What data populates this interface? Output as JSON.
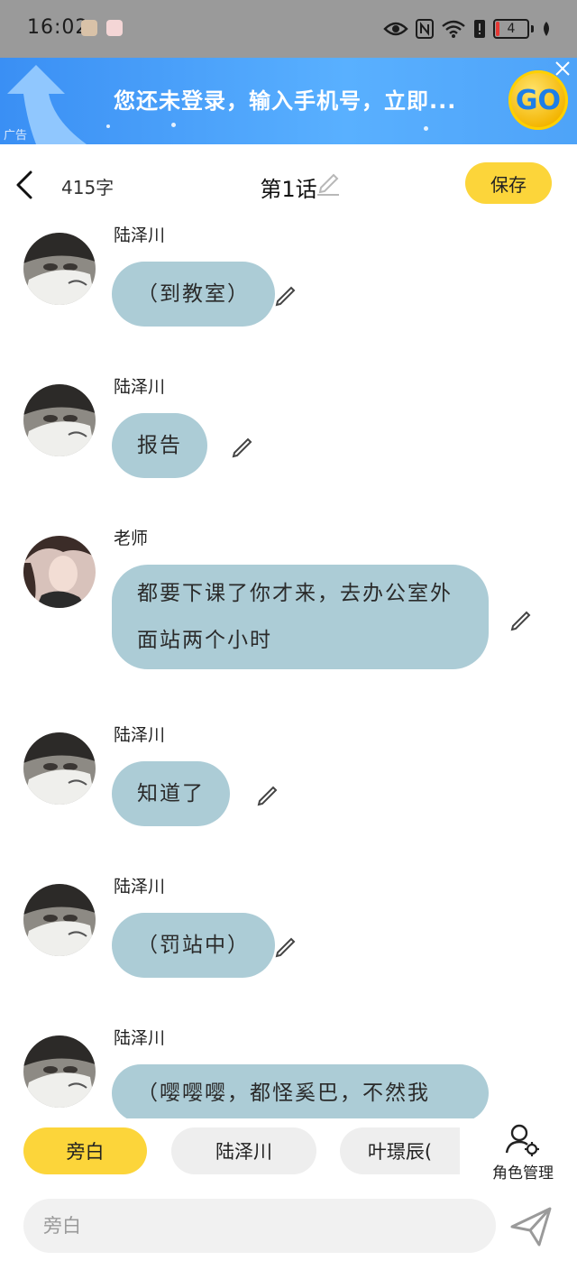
{
  "status_bar": {
    "time": "16:02",
    "battery": "4"
  },
  "ad": {
    "text": "您还未登录，输入手机号，立即...",
    "tag": "广告",
    "go": "GO"
  },
  "header": {
    "word_count": "415字",
    "title": "第1话",
    "save_label": "保存"
  },
  "messages": [
    {
      "speaker": "陆泽川",
      "text": "（到教室）",
      "avatar": "male"
    },
    {
      "speaker": "陆泽川",
      "text": "报告",
      "avatar": "male"
    },
    {
      "speaker": "老师",
      "text": "都要下课了你才来，去办公室外面站两个小时",
      "avatar": "female"
    },
    {
      "speaker": "陆泽川",
      "text": "知道了",
      "avatar": "male"
    },
    {
      "speaker": "陆泽川",
      "text": "（罚站中）",
      "avatar": "male"
    },
    {
      "speaker": "陆泽川",
      "text": "（嘤嘤嘤，都怪奚巴，不然我",
      "avatar": "male"
    }
  ],
  "roles": [
    {
      "label": "旁白",
      "active": true
    },
    {
      "label": "陆泽川",
      "active": false
    },
    {
      "label": "叶璟辰(",
      "active": false
    }
  ],
  "role_manager_label": "角色管理",
  "input": {
    "placeholder": "旁白"
  },
  "colors": {
    "accent": "#fcd53a",
    "bubble": "#acccd6",
    "ad_blue": "#3a8ff4"
  }
}
